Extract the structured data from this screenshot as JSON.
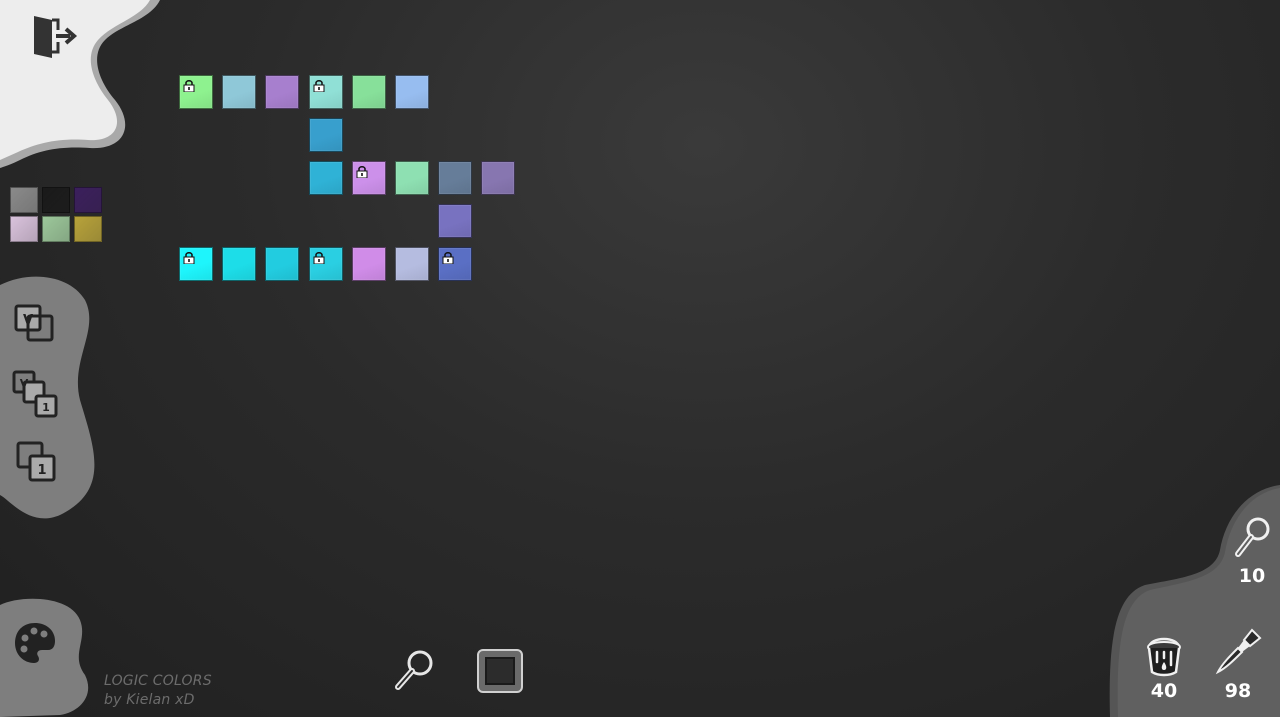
{
  "credits": {
    "line1": "LOGIC COLORS",
    "line2": "by Kielan xD"
  },
  "counters": {
    "hints": "10",
    "buckets": "40",
    "brushes": "98"
  },
  "left_toolbar": {
    "exit_icon": "exit-door-icon",
    "modes": [
      "mode-v-icon",
      "mode-v-1-icon",
      "mode-1-icon"
    ],
    "palette_icon": "palette-icon"
  },
  "bottom_toolbar": {
    "zoom_icon": "magnifier-icon",
    "frame_icon": "square-frame-icon"
  },
  "swatches": [
    {
      "name": "gray-gradient",
      "color": "#8a8a8a"
    },
    {
      "name": "black",
      "color": "#1a1a1a"
    },
    {
      "name": "purple-texture",
      "color": "#3b1f5c"
    },
    {
      "name": "pink-texture",
      "color": "#d9c2dc"
    },
    {
      "name": "green-texture",
      "color": "#9cc79a"
    },
    {
      "name": "gold-texture",
      "color": "#b7a23a"
    }
  ],
  "tiles": [
    {
      "col": 0,
      "row": 0,
      "color": "#8ef28f",
      "locked": true
    },
    {
      "col": 1,
      "row": 0,
      "color": "#8fc8d8",
      "locked": false
    },
    {
      "col": 2,
      "row": 0,
      "color": "#a77fce",
      "locked": false
    },
    {
      "col": 3,
      "row": 0,
      "color": "#90e0d6",
      "locked": true
    },
    {
      "col": 4,
      "row": 0,
      "color": "#87e09a",
      "locked": false
    },
    {
      "col": 5,
      "row": 0,
      "color": "#97bdf0",
      "locked": false
    },
    {
      "col": 3,
      "row": 1,
      "color": "#389fcd",
      "locked": false
    },
    {
      "col": 3,
      "row": 2,
      "color": "#2fb2d6",
      "locked": false
    },
    {
      "col": 4,
      "row": 2,
      "color": "#cc90ea",
      "locked": true
    },
    {
      "col": 5,
      "row": 2,
      "color": "#8ee0b2",
      "locked": false
    },
    {
      "col": 6,
      "row": 2,
      "color": "#667d99",
      "locked": false
    },
    {
      "col": 7,
      "row": 2,
      "color": "#8776b0",
      "locked": false
    },
    {
      "col": 6,
      "row": 3,
      "color": "#7872c0",
      "locked": false
    },
    {
      "col": 0,
      "row": 4,
      "color": "#1ef5fc",
      "locked": true
    },
    {
      "col": 1,
      "row": 4,
      "color": "#1ddde8",
      "locked": false
    },
    {
      "col": 2,
      "row": 4,
      "color": "#22cce0",
      "locked": false
    },
    {
      "col": 3,
      "row": 4,
      "color": "#2acfe2",
      "locked": true
    },
    {
      "col": 4,
      "row": 4,
      "color": "#d08ce8",
      "locked": false
    },
    {
      "col": 5,
      "row": 4,
      "color": "#b5bce0",
      "locked": false
    },
    {
      "col": 6,
      "row": 4,
      "color": "#5a6fc4",
      "locked": true
    }
  ]
}
